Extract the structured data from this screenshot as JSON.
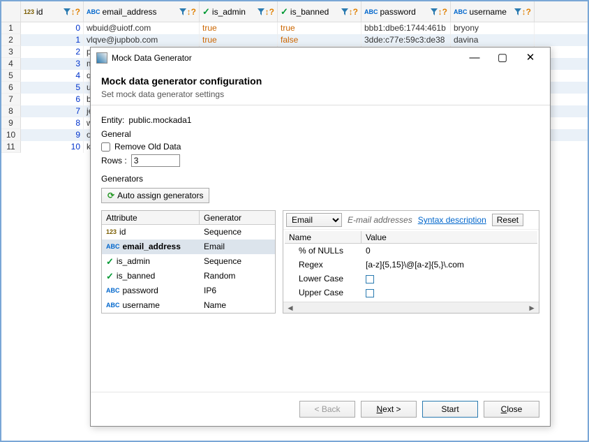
{
  "grid": {
    "columns": [
      {
        "type": "123",
        "name": "id",
        "width": 90
      },
      {
        "type": "ABC",
        "name": "email_address",
        "width": 166
      },
      {
        "type": "chk",
        "name": "is_admin",
        "width": 112
      },
      {
        "type": "chk",
        "name": "is_banned",
        "width": 120
      },
      {
        "type": "ABC",
        "name": "password",
        "width": 128
      },
      {
        "type": "ABC",
        "name": "username",
        "width": 120
      }
    ],
    "rows": [
      {
        "n": 1,
        "id": "0",
        "email": "wbuid@uiotf.com",
        "admin": "true",
        "banned": "true",
        "pw": "bbb1:dbe6:1744:461b",
        "user": "bryony"
      },
      {
        "n": 2,
        "id": "1",
        "email": "vlqve@jupbob.com",
        "admin": "true",
        "banned": "false",
        "pw": "3dde:c77e:59c3:de38",
        "user": "davina"
      },
      {
        "n": 3,
        "id": "2",
        "email": "pw",
        "admin": "",
        "banned": "",
        "pw": "",
        "user": ""
      },
      {
        "n": 4,
        "id": "3",
        "email": "m",
        "admin": "",
        "banned": "",
        "pw": "",
        "user": ""
      },
      {
        "n": 5,
        "id": "4",
        "email": "qa",
        "admin": "",
        "banned": "",
        "pw": "",
        "user": ""
      },
      {
        "n": 6,
        "id": "5",
        "email": "ub",
        "admin": "",
        "banned": "",
        "pw": "",
        "user": ""
      },
      {
        "n": 7,
        "id": "6",
        "email": "bv",
        "admin": "",
        "banned": "",
        "pw": "",
        "user": ""
      },
      {
        "n": 8,
        "id": "7",
        "email": "jej",
        "admin": "",
        "banned": "",
        "pw": "",
        "user": ""
      },
      {
        "n": 9,
        "id": "8",
        "email": "wo",
        "admin": "",
        "banned": "",
        "pw": "",
        "user": ""
      },
      {
        "n": 10,
        "id": "9",
        "email": "oh",
        "admin": "",
        "banned": "",
        "pw": "",
        "user": ""
      },
      {
        "n": 11,
        "id": "10",
        "email": "kip",
        "admin": "",
        "banned": "",
        "pw": "",
        "user": ""
      }
    ]
  },
  "dialog": {
    "title": "Mock Data Generator",
    "heading": "Mock data generator configuration",
    "subheading": "Set mock data generator settings",
    "entity_label": "Entity:",
    "entity_value": "public.mockada1",
    "general_label": "General",
    "remove_old_label": "Remove Old Data",
    "rows_label": "Rows :",
    "rows_value": "3",
    "generators_label": "Generators",
    "auto_assign_label": "Auto assign generators",
    "attr_header1": "Attribute",
    "attr_header2": "Generator",
    "attrs": [
      {
        "type": "123",
        "name": "id",
        "gen": "Sequence",
        "sel": false
      },
      {
        "type": "ABC",
        "name": "email_address",
        "gen": "Email",
        "sel": true
      },
      {
        "type": "chk",
        "name": "is_admin",
        "gen": "Sequence",
        "sel": false
      },
      {
        "type": "chk",
        "name": "is_banned",
        "gen": "Random",
        "sel": false
      },
      {
        "type": "ABC",
        "name": "password",
        "gen": "IP6",
        "sel": false
      },
      {
        "type": "ABC",
        "name": "username",
        "gen": "Name",
        "sel": false
      }
    ],
    "gen_select": "Email",
    "gen_desc": "E-mail addresses",
    "syntax_link": "Syntax description",
    "reset_label": "Reset",
    "props_h1": "Name",
    "props_h2": "Value",
    "props": [
      {
        "name": "% of NULLs",
        "value": "0",
        "check": false
      },
      {
        "name": "Regex",
        "value": "[a-z]{5,15}\\@[a-z]{5,}\\.com",
        "check": false
      },
      {
        "name": "Lower Case",
        "value": "",
        "check": true
      },
      {
        "name": "Upper Case",
        "value": "",
        "check": true
      }
    ],
    "back_label": "< Back",
    "next_label": "Next >",
    "start_label": "Start",
    "close_label": "Close"
  }
}
